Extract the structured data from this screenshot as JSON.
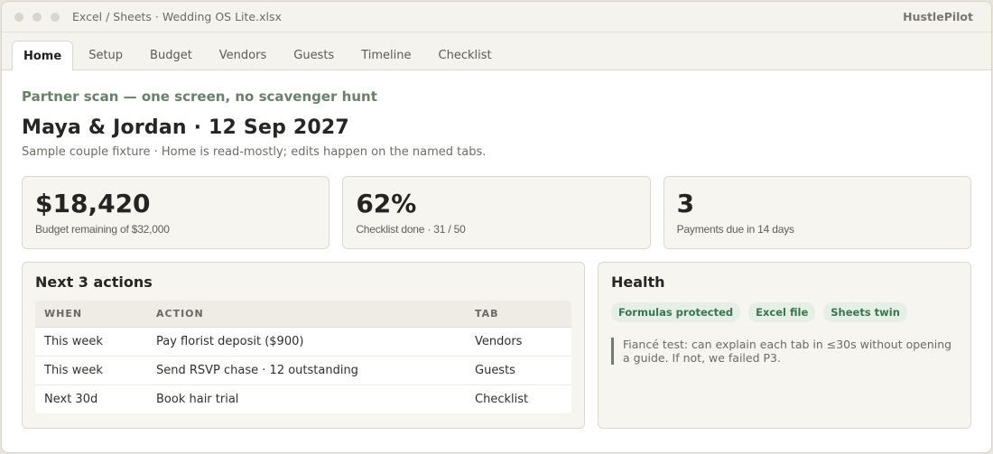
{
  "window": {
    "title": "Excel / Sheets · Wedding OS Lite.xlsx",
    "brand": "HustlePilot"
  },
  "tabs": [
    {
      "label": "Home",
      "active": true
    },
    {
      "label": "Setup"
    },
    {
      "label": "Budget"
    },
    {
      "label": "Vendors"
    },
    {
      "label": "Guests"
    },
    {
      "label": "Timeline"
    },
    {
      "label": "Checklist"
    }
  ],
  "header": {
    "kicker": "Partner scan — one screen, no scavenger hunt",
    "title": "Maya & Jordan · 12 Sep 2027",
    "subtitle": "Sample couple fixture · Home is read-mostly; edits happen on the named tabs."
  },
  "cards": [
    {
      "value": "$18,420",
      "label": "Budget remaining of $32,000"
    },
    {
      "value": "62%",
      "label": "Checklist done · 31 / 50"
    },
    {
      "value": "3",
      "label": "Payments due in 14 days"
    }
  ],
  "actions": {
    "title": "Next 3 actions",
    "columns": [
      "WHEN",
      "ACTION",
      "TAB"
    ],
    "rows": [
      {
        "when": "This week",
        "action": "Pay florist deposit ($900)",
        "tab": "Vendors"
      },
      {
        "when": "This week",
        "action": "Send RSVP chase · 12 outstanding",
        "tab": "Guests"
      },
      {
        "when": "Next 30d",
        "action": "Book hair trial",
        "tab": "Checklist"
      }
    ]
  },
  "health": {
    "title": "Health",
    "badges": [
      "Formulas protected",
      "Excel file",
      "Sheets twin"
    ],
    "note": "Fiancé test: can explain each tab in ≤30s without opening a guide. If not, we failed P3."
  },
  "colors": {
    "accent": "#6a8069",
    "badge_bg": "#e5efe6",
    "badge_text": "#3b7451"
  }
}
